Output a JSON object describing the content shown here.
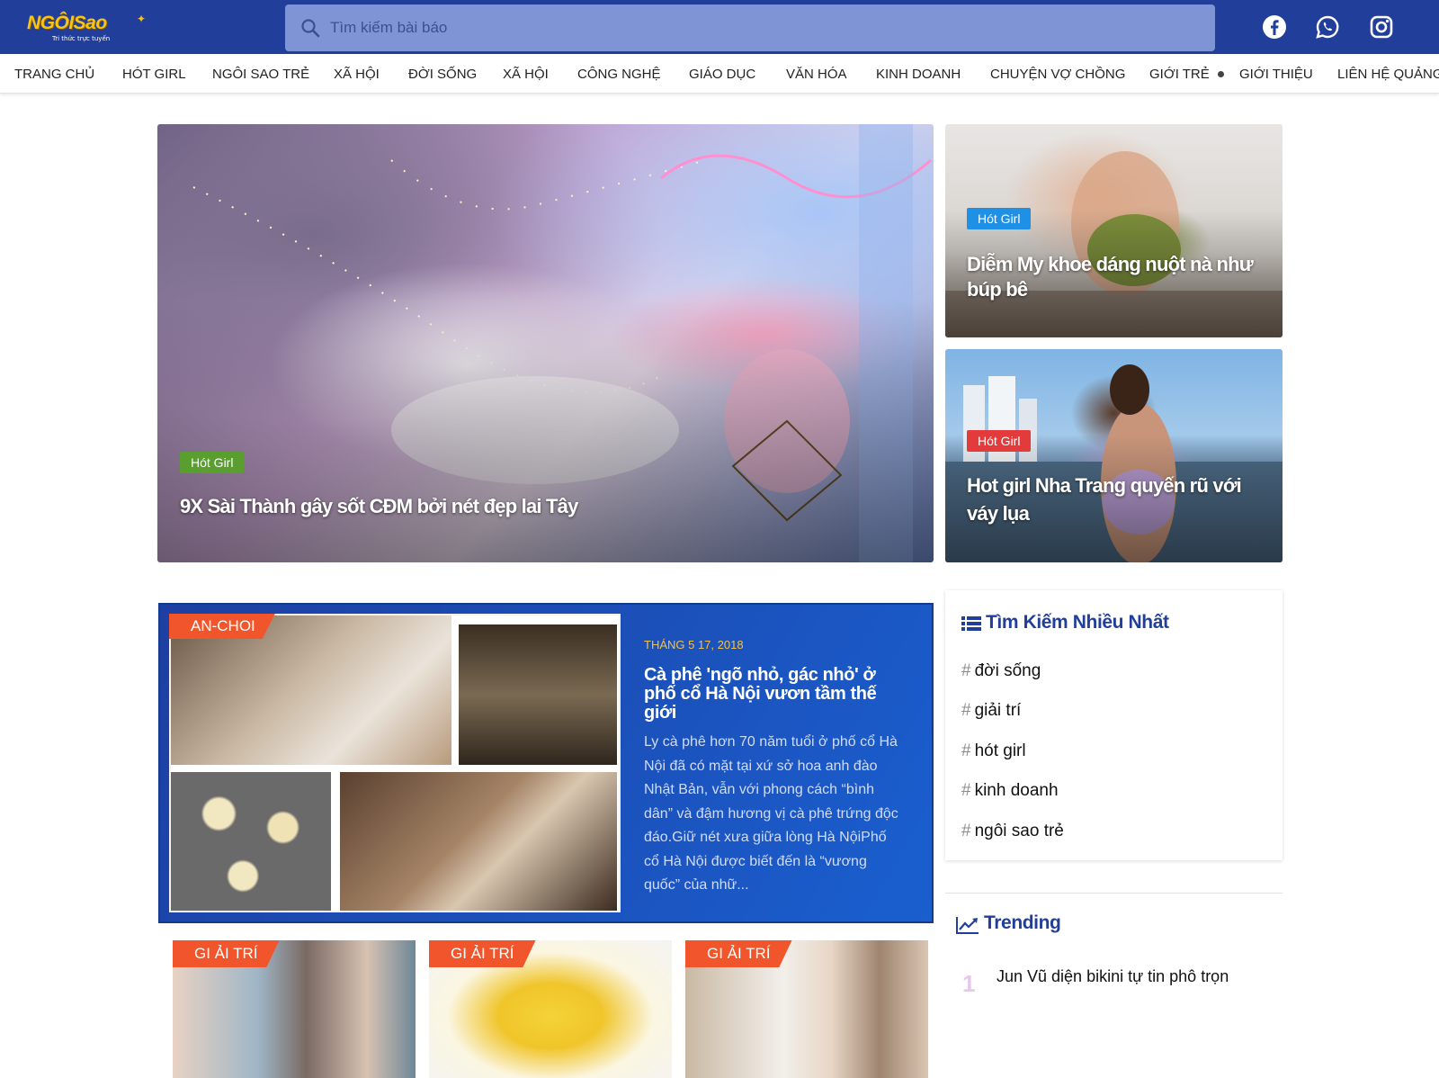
{
  "header": {
    "logo_text": "NGÔISao",
    "logo_tagline": "Tri thức trực tuyến",
    "search_placeholder": "Tìm kiếm bài báo",
    "social_icons": [
      "facebook-icon",
      "whatsapp-icon",
      "instagram-icon"
    ],
    "bg_color": "#213f9a"
  },
  "nav": {
    "items": [
      "TRANG CHỦ",
      "HÓT GIRL",
      "NGÔI SAO TRẺ",
      "XÃ HỘI",
      "ĐỜI SỐNG",
      "XÃ HỘI",
      "CÔNG NGHỆ",
      "GIÁO DỤC",
      "VĂN HÓA",
      "KINH DOANH",
      "CHUYỆN VỢ CHỒNG",
      "GIỚI TRẺ",
      "GIỚI THIỆU",
      "LIÊN HỆ QUẢNG"
    ]
  },
  "hero": {
    "main": {
      "category": "Hót Girl",
      "category_color": "#5a9e2f",
      "title": "9X Sài Thành gây sốt CĐM bởi nét đẹp lai Tây"
    },
    "side": [
      {
        "category": "Hót Girl",
        "category_color": "#1e90e6",
        "title_line1": "Diễm My khoe dáng nuột nà như",
        "title_line2": "búp bê"
      },
      {
        "category": "Hót Girl",
        "category_color": "#e33b3b",
        "title_line1": "Hot girl Nha Trang quyến rũ với",
        "title_line2": "váy lụa"
      }
    ]
  },
  "featured": {
    "category": "AN-CHOI",
    "date": "THÁNG 5 17, 2018",
    "title": "Cà phê 'ngõ nhỏ, gác nhỏ' ở phố cổ Hà Nội vươn tầm thế giới",
    "description": "Ly cà phê hơn 70 năm tuổi ở phố cổ Hà Nội đã có mặt tại xứ sở hoa anh đào Nhật Bản, vẫn với phong cách “bình dân” và đậm hương vị cà phê trứng độc đáo.Giữ nét xưa giữa lòng Hà NộiPhố cổ Hà Nội được biết đến là “vương quốc” của nhữ..."
  },
  "small_cards": [
    {
      "category": "GI ẢI TRÍ"
    },
    {
      "category": "GI ẢI TRÍ"
    },
    {
      "category": "GI ẢI TRÍ"
    }
  ],
  "sidebar": {
    "popular_title": "Tìm Kiếm Nhiều Nhất",
    "tags": [
      "đời sống",
      "giải trí",
      "hót girl",
      "kinh doanh",
      "ngôi sao trẻ"
    ],
    "trending_title": "Trending",
    "trending": [
      {
        "rank": "1",
        "title": "Jun Vũ diện bikini tự tin phô trọn"
      }
    ]
  }
}
